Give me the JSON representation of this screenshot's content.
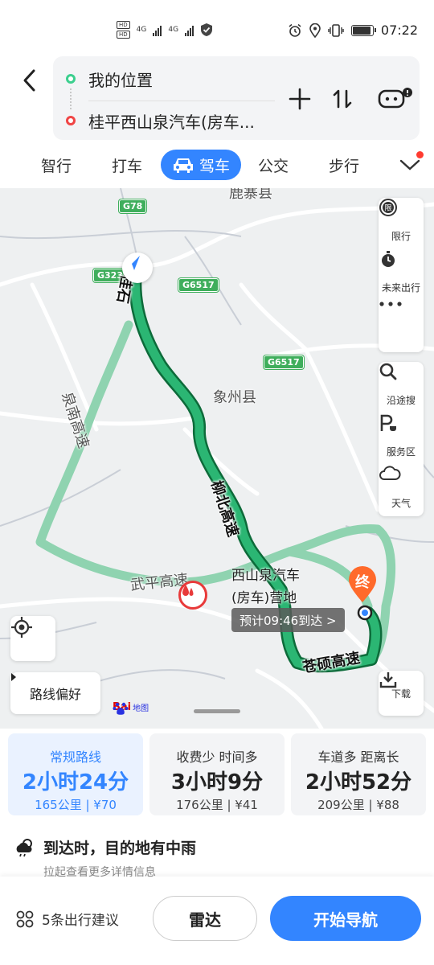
{
  "status_bar": {
    "net1": "4G",
    "net2": "4G",
    "time": "07:22",
    "battery_level": 0.85
  },
  "route": {
    "start": "我的位置",
    "end": "桂平西山泉汽车(房车..."
  },
  "tabs": [
    {
      "label": "智行"
    },
    {
      "label": "打车"
    },
    {
      "label": "驾车",
      "active": true
    },
    {
      "label": "公交"
    },
    {
      "label": "步行"
    }
  ],
  "map": {
    "shields": [
      "G78",
      "G323",
      "G6517",
      "G6517"
    ],
    "county_top": "鹿寨县",
    "county_mid": "象州县",
    "roads": {
      "a": "泉南高速",
      "b": "柳北高速",
      "c": "武平高速",
      "d": "苍硕高速",
      "e": "桂石"
    },
    "destination_label_line1": "西山泉汽车",
    "destination_label_line2": "(房车)营地",
    "eta": "预计09:46到达 >",
    "dest_pin_text": "终",
    "preference_label": "路线偏好",
    "download_label": "下载",
    "logo_text": "Bai",
    "logo_suffix": "地图"
  },
  "side_panel_top": [
    {
      "label": "限行",
      "icon": "restriction-icon"
    },
    {
      "label": "未来出行",
      "icon": "stopwatch-icon"
    },
    {
      "label": "",
      "icon": "more-icon"
    }
  ],
  "side_panel_bottom": [
    {
      "label": "沿途搜",
      "icon": "search-icon"
    },
    {
      "label": "服务区",
      "icon": "service-area-icon"
    },
    {
      "label": "天气",
      "icon": "weather-icon"
    }
  ],
  "route_options": [
    {
      "title": "常规路线",
      "duration": "2小时24分",
      "meta": "165公里 | ¥70",
      "active": true
    },
    {
      "title": "收费少  时间多",
      "duration": "3小时9分",
      "meta": "176公里 | ¥41",
      "active": false
    },
    {
      "title": "车道多  距离长",
      "duration": "2小时52分",
      "meta": "209公里 | ¥88",
      "active": false
    }
  ],
  "weather": {
    "title": "到达时，目的地有中雨",
    "subtitle": "拉起查看更多详情信息"
  },
  "bottom": {
    "suggest": "5条出行建议",
    "radar": "雷达",
    "navigate": "开始导航"
  },
  "colors": {
    "accent": "#3385ff",
    "route": "#2bb673",
    "route_alt": "#8fd3b0",
    "end_dot": "#f04545",
    "start_dot": "#3ccf8e"
  }
}
